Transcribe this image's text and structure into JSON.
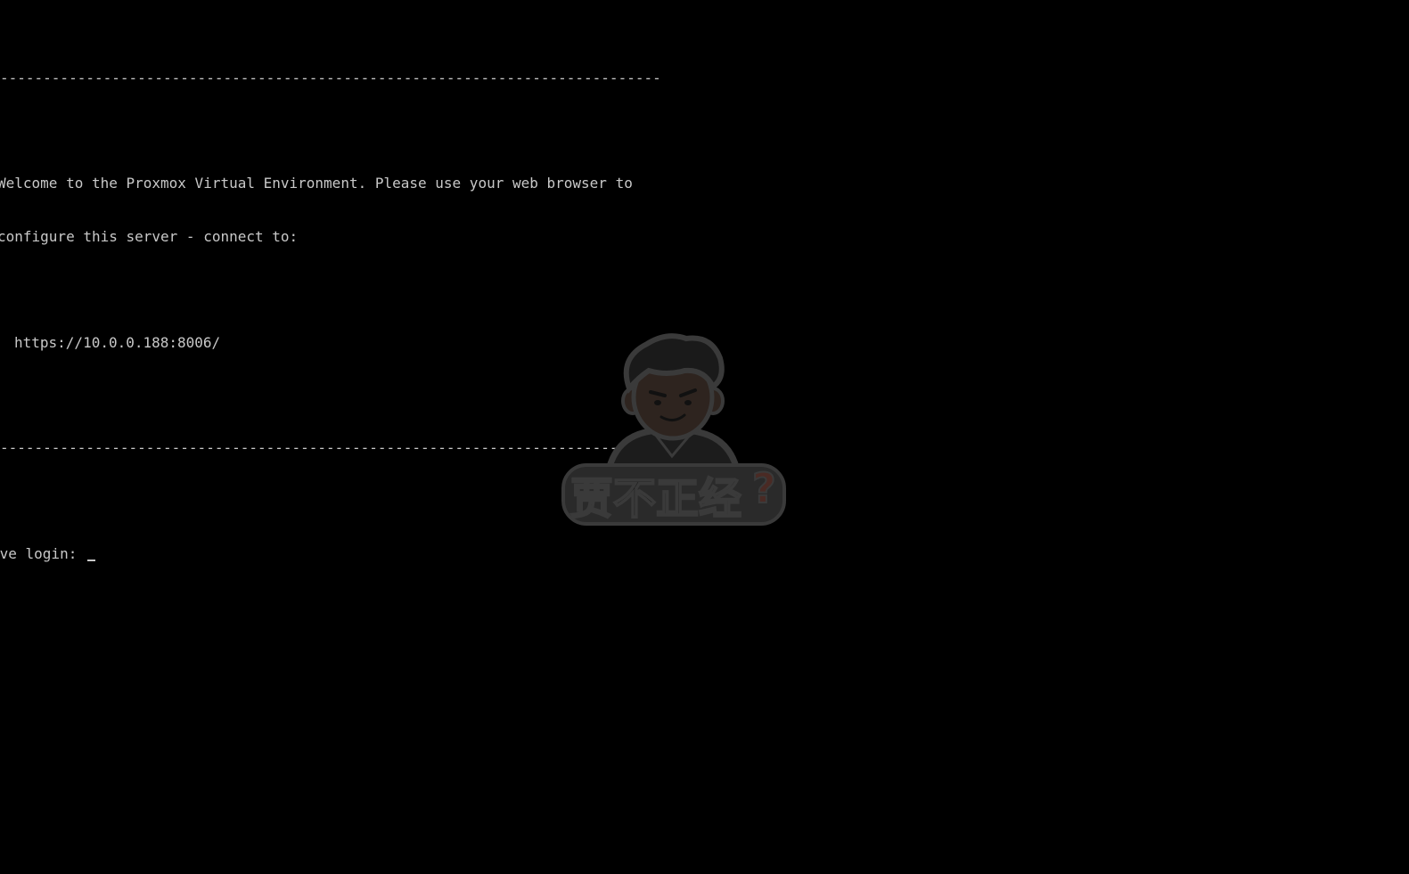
{
  "console": {
    "rule_top": "-----------------------------------------------------------------------------",
    "welcome_line_1": "Welcome to the Proxmox Virtual Environment. Please use your web browser to",
    "welcome_line_2": "configure this server - connect to:",
    "url": "https://10.0.0.188:8006/",
    "rule_bottom": "-----------------------------------------------------------------------------",
    "login_prompt": "pve login:"
  },
  "watermark": {
    "text": "贾不正经",
    "mark": "?",
    "icon": "cartoon-man-avatar-icon"
  },
  "colors": {
    "background": "#000000",
    "console_text": "#c8c8c8",
    "watermark_fill": "#2a2a2a",
    "watermark_outline": "#3a3a3a",
    "watermark_accent": "#4a2a24"
  }
}
